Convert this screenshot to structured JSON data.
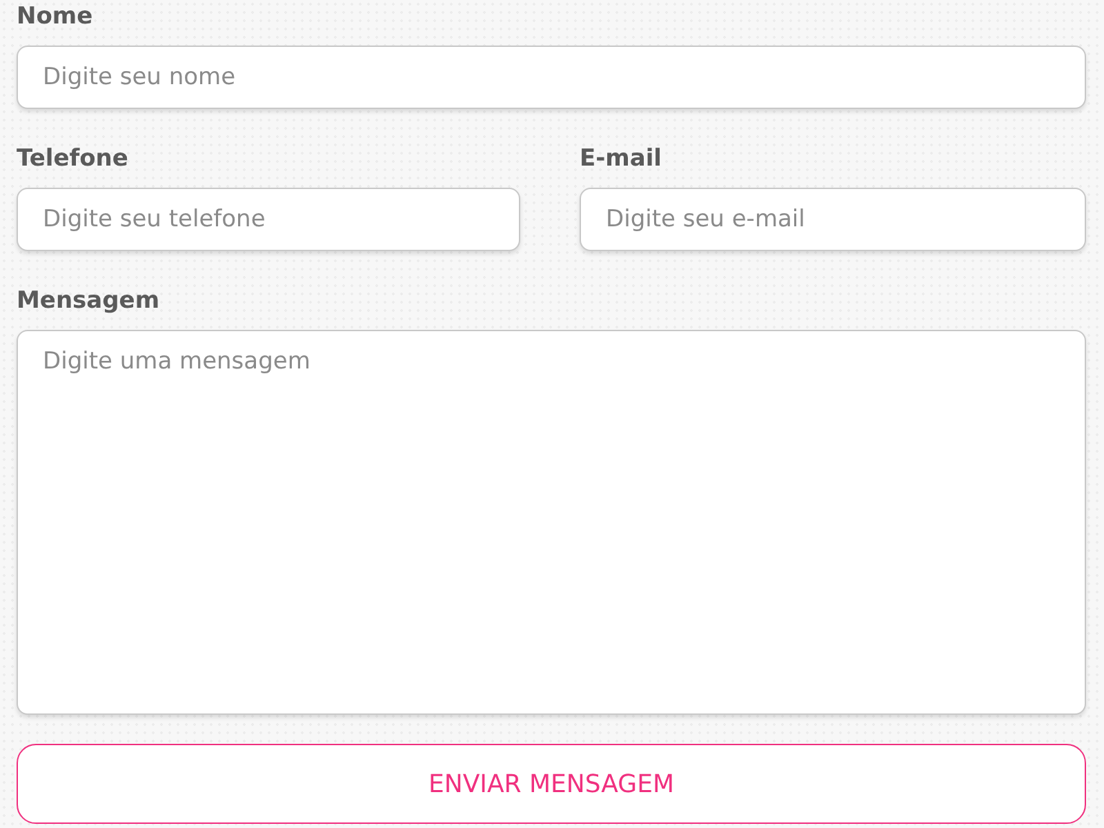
{
  "fields": [
    {
      "label": "Nome",
      "placeholder": "Digite seu nome",
      "kind": "input"
    },
    {
      "label": "Telefone",
      "placeholder": "Digite seu telefone",
      "kind": "input"
    },
    {
      "label": "E-mail",
      "placeholder": "Digite seu e-mail",
      "kind": "input"
    },
    {
      "label": "Mensagem",
      "placeholder": "Digite uma mensagem",
      "kind": "textarea"
    }
  ],
  "button": "ENVIAR MENSAGEM"
}
